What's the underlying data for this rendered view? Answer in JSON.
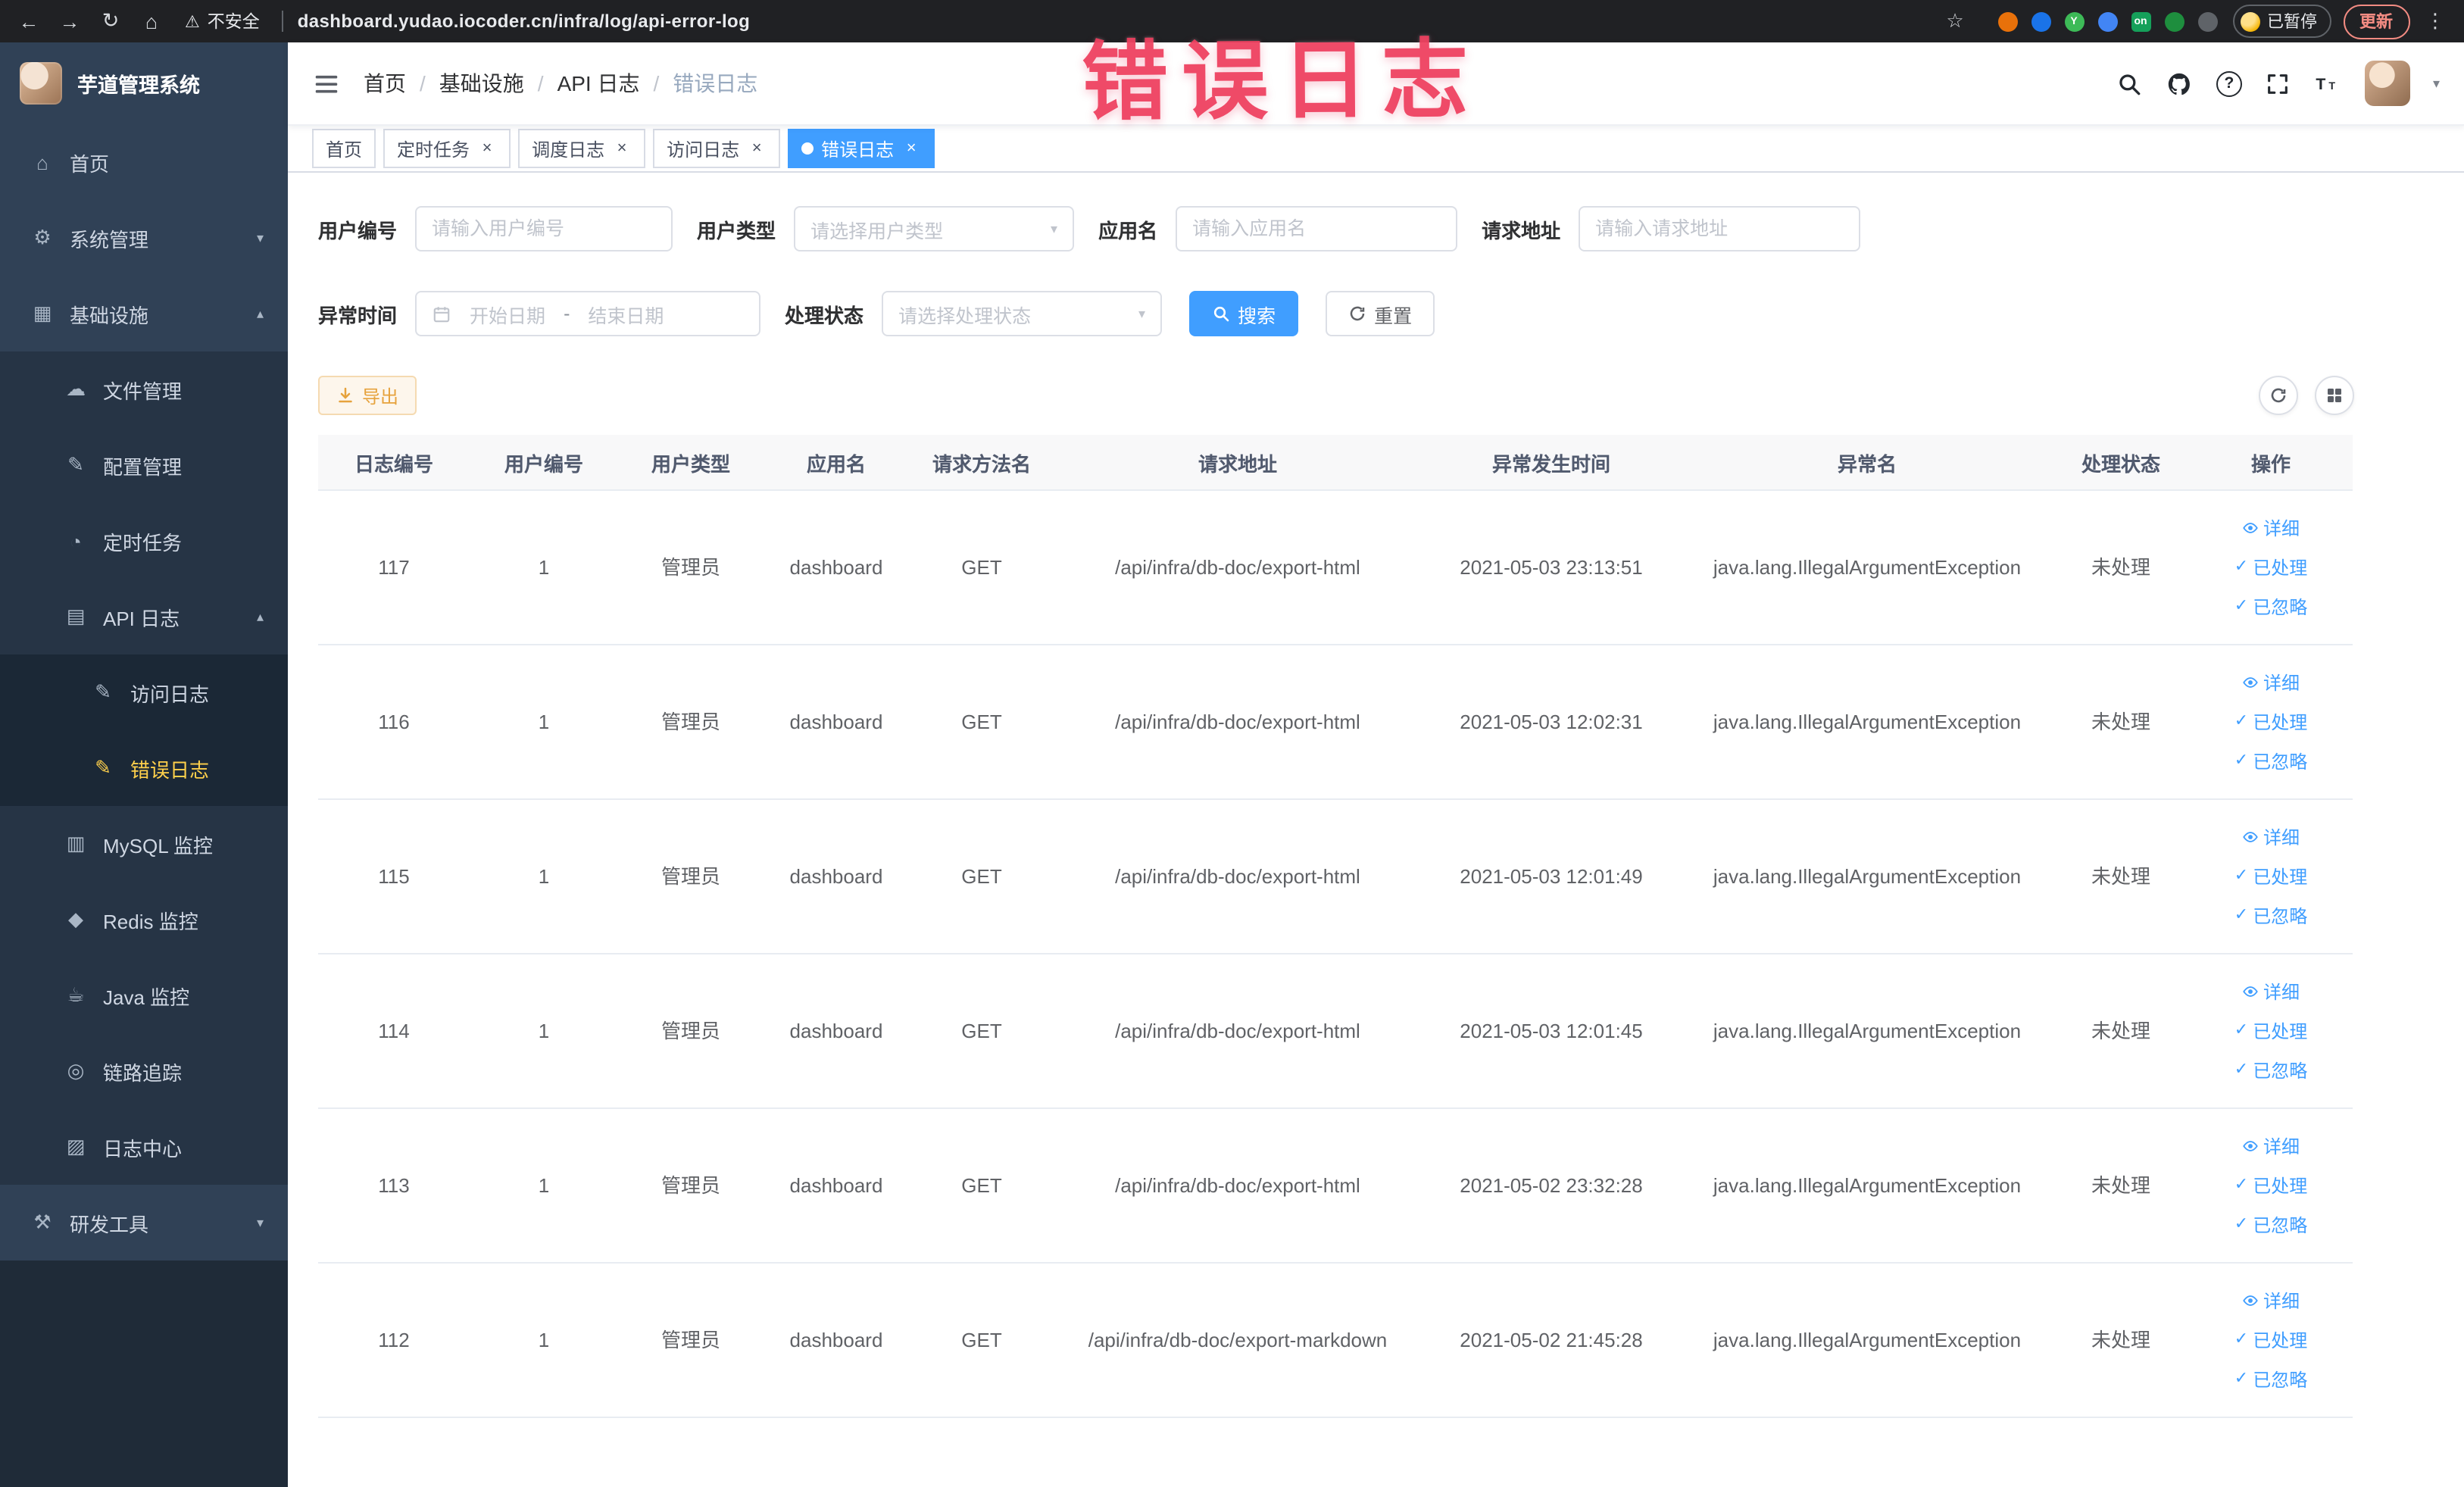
{
  "browser": {
    "security_label": "不安全",
    "url": "dashboard.yudao.iocoder.cn/infra/log/api-error-log",
    "extensions": [
      {
        "key": "ext-orange",
        "color": "#e8710a"
      },
      {
        "key": "ext-blue-drop",
        "color": "#1a73e8"
      },
      {
        "key": "ext-green-y",
        "color": "#3dba57",
        "letter": "Y"
      },
      {
        "key": "ext-blue-grid",
        "color": "#4285f4"
      },
      {
        "key": "ext-green-on",
        "color": "#15a05a",
        "letter": "on"
      },
      {
        "key": "ext-green-leaf",
        "color": "#1e8e3e"
      },
      {
        "key": "ext-dark-puzzle",
        "color": "#5f6368"
      }
    ],
    "paused_label": "已暂停",
    "update_label": "更新"
  },
  "annotation": {
    "text": "错误日志"
  },
  "sidebar": {
    "title": "芋道管理系统",
    "items": [
      {
        "key": "home",
        "label": "首页",
        "level": 1,
        "icon": "home"
      },
      {
        "key": "system",
        "label": "系统管理",
        "level": 1,
        "icon": "gear",
        "arrow": "down"
      },
      {
        "key": "infra",
        "label": "基础设施",
        "level": 1,
        "icon": "grid",
        "arrow": "up"
      },
      {
        "key": "file",
        "label": "文件管理",
        "level": 2,
        "icon": "cloud"
      },
      {
        "key": "config",
        "label": "配置管理",
        "level": 2,
        "icon": "edit"
      },
      {
        "key": "job",
        "label": "定时任务",
        "level": 2,
        "icon": "clock"
      },
      {
        "key": "api-log",
        "label": "API 日志",
        "level": 2,
        "icon": "doc",
        "arrow": "up"
      },
      {
        "key": "access-log",
        "label": "访问日志",
        "level": 3,
        "icon": "edit-doc"
      },
      {
        "key": "error-log",
        "label": "错误日志",
        "level": 3,
        "icon": "edit-doc",
        "active": true
      },
      {
        "key": "mysql",
        "label": "MySQL 监控",
        "level": 2,
        "icon": "db"
      },
      {
        "key": "redis",
        "label": "Redis 监控",
        "level": 2,
        "icon": "diamond"
      },
      {
        "key": "java",
        "label": "Java 监控",
        "level": 2,
        "icon": "cup"
      },
      {
        "key": "trace",
        "label": "链路追踪",
        "level": 2,
        "icon": "target"
      },
      {
        "key": "log-center",
        "label": "日志中心",
        "level": 2,
        "icon": "doc2"
      },
      {
        "key": "dev-tools",
        "label": "研发工具",
        "level": 1,
        "icon": "hammer",
        "arrow": "down"
      }
    ]
  },
  "header": {
    "breadcrumbs": [
      "首页",
      "基础设施",
      "API 日志",
      "错误日志"
    ],
    "breadcrumb_separator": "/"
  },
  "ui": {
    "close_glyph": "×"
  },
  "tabs": [
    {
      "key": "home",
      "label": "首页",
      "closable": false,
      "active": false
    },
    {
      "key": "timed-task",
      "label": "定时任务",
      "closable": true,
      "active": false
    },
    {
      "key": "schedule-log",
      "label": "调度日志",
      "closable": true,
      "active": false
    },
    {
      "key": "access-log",
      "label": "访问日志",
      "closable": true,
      "active": false
    },
    {
      "key": "error-log",
      "label": "错误日志",
      "closable": true,
      "active": true
    }
  ],
  "filters": {
    "user_id": {
      "label": "用户编号",
      "placeholder": "请输入用户编号"
    },
    "user_type": {
      "label": "用户类型",
      "placeholder": "请选择用户类型"
    },
    "app_name": {
      "label": "应用名",
      "placeholder": "请输入应用名"
    },
    "request_url": {
      "label": "请求地址",
      "placeholder": "请输入请求地址"
    },
    "exception_time": {
      "label": "异常时间",
      "start_placeholder": "开始日期",
      "separator": "-",
      "end_placeholder": "结束日期"
    },
    "process_status": {
      "label": "处理状态",
      "placeholder": "请选择处理状态"
    },
    "search_label": "搜索",
    "reset_label": "重置"
  },
  "toolbar": {
    "export_label": "导出"
  },
  "table": {
    "columns": [
      "日志编号",
      "用户编号",
      "用户类型",
      "应用名",
      "请求方法名",
      "请求地址",
      "异常发生时间",
      "异常名",
      "处理状态",
      "操作"
    ],
    "action_labels": {
      "detail": "详细",
      "processed": "已处理",
      "ignored": "已忽略"
    },
    "rows": [
      {
        "id": "117",
        "user_id": "1",
        "user_type": "管理员",
        "app": "dashboard",
        "method": "GET",
        "url": "/api/infra/db-doc/export-html",
        "time": "2021-05-03 23:13:51",
        "exception": "java.lang.IllegalArgumentException",
        "status": "未处理"
      },
      {
        "id": "116",
        "user_id": "1",
        "user_type": "管理员",
        "app": "dashboard",
        "method": "GET",
        "url": "/api/infra/db-doc/export-html",
        "time": "2021-05-03 12:02:31",
        "exception": "java.lang.IllegalArgumentException",
        "status": "未处理"
      },
      {
        "id": "115",
        "user_id": "1",
        "user_type": "管理员",
        "app": "dashboard",
        "method": "GET",
        "url": "/api/infra/db-doc/export-html",
        "time": "2021-05-03 12:01:49",
        "exception": "java.lang.IllegalArgumentException",
        "status": "未处理"
      },
      {
        "id": "114",
        "user_id": "1",
        "user_type": "管理员",
        "app": "dashboard",
        "method": "GET",
        "url": "/api/infra/db-doc/export-html",
        "time": "2021-05-03 12:01:45",
        "exception": "java.lang.IllegalArgumentException",
        "status": "未处理"
      },
      {
        "id": "113",
        "user_id": "1",
        "user_type": "管理员",
        "app": "dashboard",
        "method": "GET",
        "url": "/api/infra/db-doc/export-html",
        "time": "2021-05-02 23:32:28",
        "exception": "java.lang.IllegalArgumentException",
        "status": "未处理"
      },
      {
        "id": "112",
        "user_id": "1",
        "user_type": "管理员",
        "app": "dashboard",
        "method": "GET",
        "url": "/api/infra/db-doc/export-markdown",
        "time": "2021-05-02 21:45:28",
        "exception": "java.lang.IllegalArgumentException",
        "status": "未处理"
      }
    ]
  }
}
